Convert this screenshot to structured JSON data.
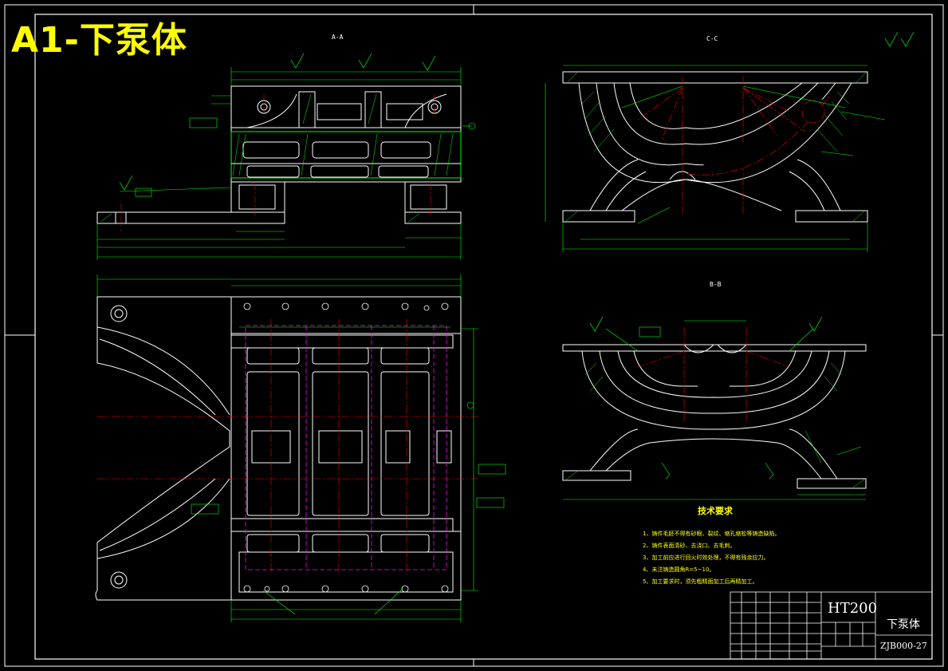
{
  "sheet": {
    "title": "A1-下泵体"
  },
  "views": {
    "section_a": "A-A",
    "section_c": "C-C",
    "section_b": "B-B"
  },
  "tech_req": {
    "heading": "技术要求",
    "items": [
      "1、铸件毛胚不得有砂眼、裂纹、缩孔缩松等铸造缺陷。",
      "2、铸件表面清砂、去浇口、去毛刺。",
      "3、加工前应进行回火时效处理，不得有残余应力。",
      "4、未注铸造圆角R=5~10。",
      "5、加工要求时，须先粗精面加工后再精加工。"
    ]
  },
  "title_block": {
    "material": "HT200",
    "part_name": "下泵体",
    "drawing_no": "ZJB000-27"
  },
  "colors": {
    "outline": "#ffffff",
    "dimension": "#00ff00",
    "center": "#ff0000",
    "hidden": "#ff00ff",
    "title": "#ffff00",
    "hatch": "#00ff00"
  }
}
